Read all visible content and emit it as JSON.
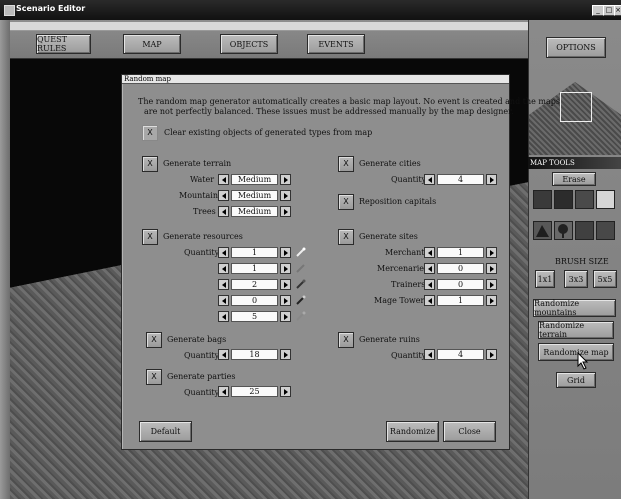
{
  "window": {
    "title": "Scenario Editor"
  },
  "topbar": {
    "quest_rules": "QUEST RULES",
    "map": "MAP",
    "objects": "OBJECTS",
    "events": "EVENTS"
  },
  "rightpanel": {
    "options": "OPTIONS",
    "map_tools": "MAP TOOLS",
    "erase": "Erase",
    "brush_size": "BRUSH SIZE",
    "brush_1": "1x1",
    "brush_3": "3x3",
    "brush_5": "5x5",
    "randomize_mountains": "Randomize mountains",
    "randomize_terrain": "Randomize terrain",
    "randomize_map": "Randomize map",
    "grid": "Grid"
  },
  "dialog": {
    "title": "Random map",
    "intro_1": "The random map generator automatically creates a basic map layout.  No event is created and the maps",
    "intro_2": "are not perfectly balanced. These issues must be addressed manually by the map designer.",
    "clear_label": "Clear existing objects of generated types from map",
    "checkbox_mark": "X",
    "terrain": {
      "label": "Generate terrain",
      "water_label": "Water",
      "water_value": "Medium",
      "mountains_label": "Mountains",
      "mountains_value": "Medium",
      "trees_label": "Trees",
      "trees_value": "Medium"
    },
    "cities": {
      "label": "Generate cities",
      "quantity_label": "Quantity",
      "quantity": "4"
    },
    "reposition_label": "Reposition capitals",
    "resources": {
      "label": "Generate resources",
      "quantity_label": "Quantity",
      "values": [
        "1",
        "1",
        "2",
        "0",
        "5"
      ]
    },
    "sites": {
      "label": "Generate sites",
      "merchants_label": "Merchants",
      "merchants": "1",
      "mercenaries_label": "Mercenaries",
      "mercenaries": "0",
      "trainers_label": "Trainers",
      "trainers": "0",
      "mage_towers_label": "Mage Towers",
      "mage_towers": "1"
    },
    "bags": {
      "label": "Generate bags",
      "quantity_label": "Quantity",
      "quantity": "18"
    },
    "ruins": {
      "label": "Generate ruins",
      "quantity_label": "Quantity",
      "quantity": "4"
    },
    "parties": {
      "label": "Generate parties",
      "quantity_label": "Quantity",
      "quantity": "25"
    },
    "default_btn": "Default",
    "randomize_btn": "Randomize",
    "close_btn": "Close"
  },
  "colors": {
    "titlebar": "#111111",
    "dialog_bg": "#8e8e8e",
    "field_bg": "#fafafa",
    "button_face": "#b0b0b0"
  }
}
